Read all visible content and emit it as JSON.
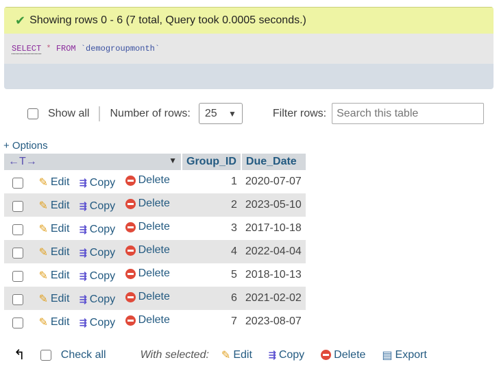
{
  "message": {
    "text": "Showing rows 0 - 6 (7 total, Query took 0.0005 seconds.)",
    "icon": "check-icon"
  },
  "sql": {
    "select": "SELECT",
    "star": "*",
    "from": "FROM",
    "table": "`demogroupmonth`"
  },
  "controls": {
    "show_all": "Show all",
    "number_of_rows_label": "Number of rows:",
    "number_of_rows": "25",
    "filter_label": "Filter rows:",
    "search_placeholder": "Search this table"
  },
  "options": "+ Options",
  "table": {
    "columns": [
      "Group_ID",
      "Due_Date"
    ],
    "actions": {
      "edit": "Edit",
      "copy": "Copy",
      "delete": "Delete"
    },
    "rows": [
      [
        "1",
        "2020-07-07"
      ],
      [
        "2",
        "2023-05-10"
      ],
      [
        "3",
        "2017-10-18"
      ],
      [
        "4",
        "2022-04-04"
      ],
      [
        "5",
        "2018-10-13"
      ],
      [
        "6",
        "2021-02-02"
      ],
      [
        "7",
        "2023-08-07"
      ]
    ]
  },
  "footer": {
    "check_all": "Check all",
    "with_selected": "With selected:",
    "edit": "Edit",
    "copy": "Copy",
    "delete": "Delete",
    "export": "Export"
  }
}
